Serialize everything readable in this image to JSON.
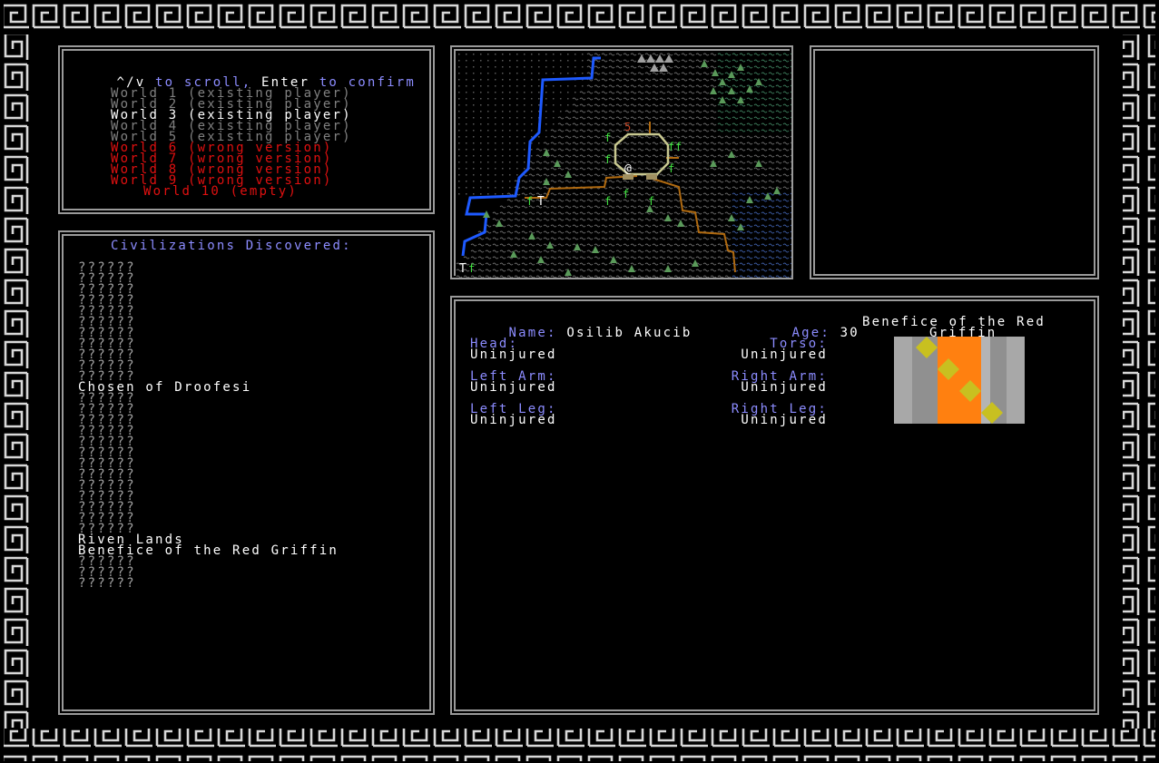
{
  "colors": {
    "background": "#000000",
    "frame": "#c8c8c8",
    "label_blue": "#8c8cff",
    "selected_white": "#ffffff",
    "existing_grey": "#808080",
    "wrong_red": "#e01010",
    "river_blue": "#1e5aff",
    "road_brown": "#b06a10",
    "tree_green": "#5a9a5a",
    "banner_orange": "#ff8010",
    "banner_yellow": "#c8c020"
  },
  "world_select": {
    "instructions": {
      "keys": "^/v",
      "to_scroll": " to scroll, ",
      "enter": "Enter",
      "to_confirm": " to confirm"
    },
    "items": [
      {
        "label": "World 1 (existing player)",
        "status": "existing"
      },
      {
        "label": "World 2 (existing player)",
        "status": "existing"
      },
      {
        "label": "World 3 (existing player)",
        "status": "selected"
      },
      {
        "label": "World 4 (existing player)",
        "status": "existing"
      },
      {
        "label": "World 5 (existing player)",
        "status": "existing"
      },
      {
        "label": "World 6 (wrong version)",
        "status": "wrong"
      },
      {
        "label": "World 7 (wrong version)",
        "status": "wrong"
      },
      {
        "label": "World 8 (wrong version)",
        "status": "wrong"
      },
      {
        "label": "World 9 (wrong version)",
        "status": "wrong"
      },
      {
        "label": "World 10 (empty)",
        "status": "empty"
      }
    ]
  },
  "civilizations": {
    "title": "Civilizations Discovered:",
    "entries": [
      "??????",
      "??????",
      "??????",
      "??????",
      "??????",
      "??????",
      "??????",
      "??????",
      "??????",
      "??????",
      "??????",
      "Chosen of Droofesi",
      "??????",
      "??????",
      "??????",
      "??????",
      "??????",
      "??????",
      "??????",
      "??????",
      "??????",
      "??????",
      "??????",
      "??????",
      "??????",
      "Riven Lands",
      "Benefice of the Red Griffin",
      "??????",
      "??????",
      "??????"
    ]
  },
  "map": {
    "player_glyph": "@",
    "site_glyph": "5",
    "town_glyph": "T",
    "forest_glyph": "f",
    "mountain_icon": "mountain-icon",
    "tree_icon": "tree-icon"
  },
  "character": {
    "name_label": "Name:",
    "name": "Osilib Akucib",
    "age_label": "Age:",
    "age": "30",
    "civ_line1": "Benefice of the Red",
    "civ_line2": "Griffin",
    "body_parts": [
      {
        "label": "Head:",
        "status": "Uninjured"
      },
      {
        "label": "Torso:",
        "status": "Uninjured"
      },
      {
        "label": "Left Arm:",
        "status": "Uninjured"
      },
      {
        "label": "Right Arm:",
        "status": "Uninjured"
      },
      {
        "label": "Left Leg:",
        "status": "Uninjured"
      },
      {
        "label": "Right Leg:",
        "status": "Uninjured"
      }
    ]
  }
}
